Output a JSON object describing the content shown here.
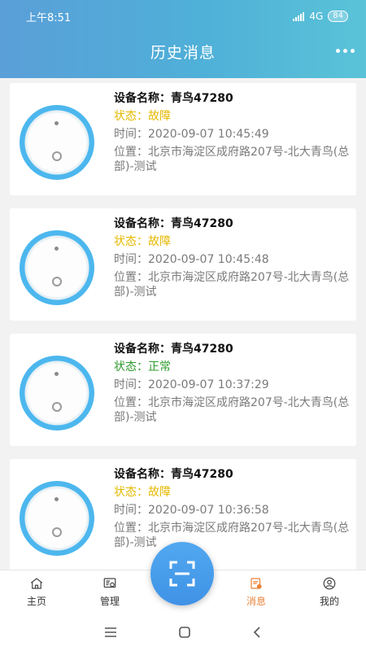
{
  "status_bar": {
    "time": "上午8:51",
    "network": "4G",
    "battery": "84"
  },
  "header": {
    "title": "历史消息"
  },
  "messages": [
    {
      "name_label": "设备名称：青鸟47280",
      "status_label": "状态：故障",
      "status_color": "#e6b800",
      "time_label": "时间：2020-09-07 10:45:49",
      "location_label": "位置：北京市海淀区成府路207号-北大青鸟(总部)-测试"
    },
    {
      "name_label": "设备名称：青鸟47280",
      "status_label": "状态：故障",
      "status_color": "#e6b800",
      "time_label": "时间：2020-09-07 10:45:48",
      "location_label": "位置：北京市海淀区成府路207号-北大青鸟(总部)-测试"
    },
    {
      "name_label": "设备名称：青鸟47280",
      "status_label": "状态：正常",
      "status_color": "#2d9c2d",
      "time_label": "时间：2020-09-07 10:37:29",
      "location_label": "位置：北京市海淀区成府路207号-北大青鸟(总部)-测试"
    },
    {
      "name_label": "设备名称：青鸟47280",
      "status_label": "状态：故障",
      "status_color": "#e6b800",
      "time_label": "时间：2020-09-07 10:36:58",
      "location_label": "位置：北京市海淀区成府路207号-北大青鸟(总部)-测试"
    }
  ],
  "tabbar": {
    "home": "主页",
    "manage": "管理",
    "messages": "消息",
    "mine": "我的",
    "active_color": "#e8823a"
  },
  "icons": {
    "scan": "scan-icon",
    "home": "home-icon",
    "manage": "manage-icon",
    "messages": "message-icon",
    "mine": "user-icon"
  }
}
